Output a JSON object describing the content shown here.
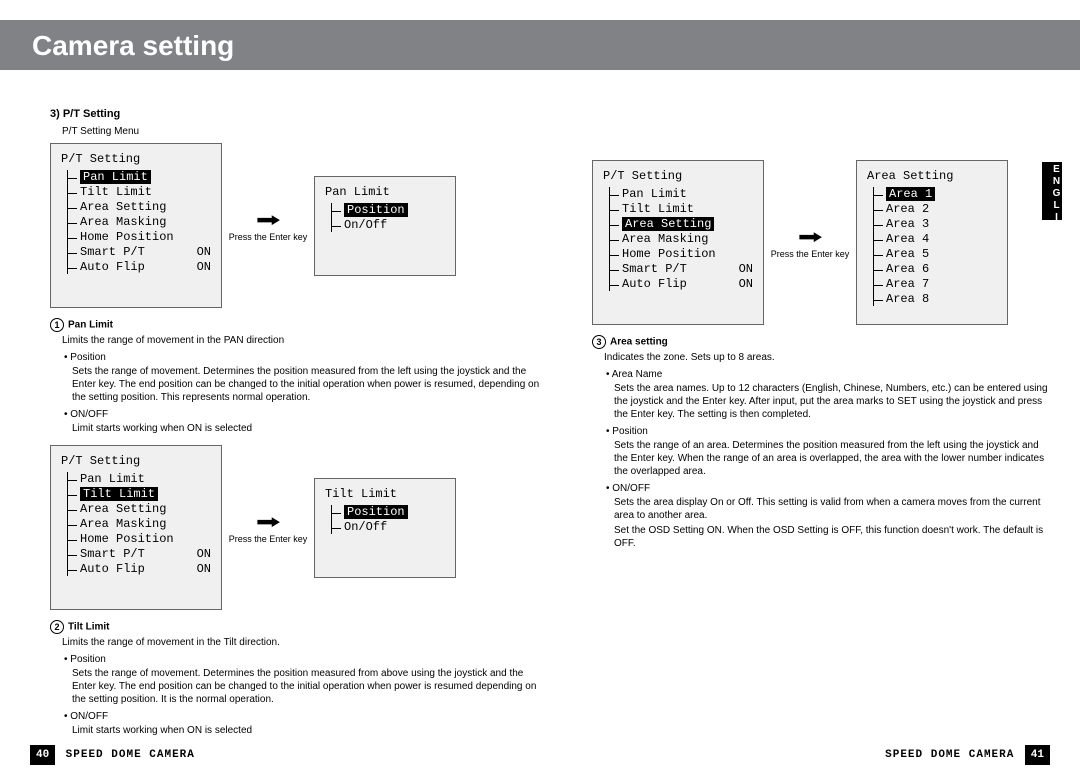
{
  "title": "Camera setting",
  "lang_tab": "ENGLISH",
  "section_heading": "3) P/T Setting",
  "menu_label": "P/T Setting Menu",
  "press_enter": "Press the Enter key",
  "pt_menu_title": "P/T Setting",
  "pt_items": {
    "pan": "Pan  Limit",
    "tilt": "Tilt Limit",
    "area_setting": "Area Setting",
    "area_masking": "Area Masking",
    "home": "Home Position",
    "smart": "Smart P/T",
    "smart_val": "ON",
    "autoflip": "Auto Flip",
    "autoflip_val": "ON"
  },
  "panlimit_title": "Pan Limit",
  "panlimit_items": {
    "position": "Position",
    "onoff": "On/Off"
  },
  "tiltlimit_title": "Tilt Limit",
  "tiltlimit_items": {
    "position": "Position",
    "onoff": "On/Off"
  },
  "area_title": "Area Setting",
  "area_names": [
    "Area 1",
    "Area 2",
    "Area 3",
    "Area 4",
    "Area 5",
    "Area 6",
    "Area 7",
    "Area 8"
  ],
  "item1": {
    "num": "1",
    "heading": "Pan Limit",
    "desc": "Limits the range of movement in the PAN direction",
    "b1": "Position",
    "b1d": "Sets the range of movement. Determines the position measured from the left using the joystick and the Enter key. The end position can be changed to the initial operation when power is resumed, depending on the setting position. This represents normal operation.",
    "b2": "ON/OFF",
    "b2d": "Limit starts working when ON is selected"
  },
  "item2": {
    "num": "2",
    "heading": "Tilt Limit",
    "desc": "Limits the range of movement in the Tilt direction.",
    "b1": "Position",
    "b1d": "Sets the range of movement. Determines the position measured from above using the joystick and the Enter key. The end position can be changed to the initial operation when power is resumed depending on the setting position. It is the normal operation.",
    "b2": "ON/OFF",
    "b2d": "Limit starts working when ON is selected"
  },
  "item3": {
    "num": "3",
    "heading": "Area setting",
    "desc": "Indicates the zone. Sets up to 8 areas.",
    "b1": "Area Name",
    "b1d": "Sets the area names. Up to 12 characters (English, Chinese, Numbers, etc.) can be entered using the joystick and the Enter key. After input, put the area marks to SET using the joystick and press the Enter key. The setting is then completed.",
    "b2": "Position",
    "b2d": "Sets the range of an area. Determines the position measured from the left using the joystick and the Enter key. When the range of an area is overlapped, the area with the lower number indicates the overlapped area.",
    "b3": "ON/OFF",
    "b3d": "Sets the area display On or Off. This setting is valid from when a camera moves from the current area to another area.",
    "b3d2": "Set the OSD Setting ON. When the OSD Setting is OFF, this function doesn't work. The default is OFF."
  },
  "footer": {
    "left_num": "40",
    "left_txt": "SPEED DOME CAMERA",
    "right_txt": "SPEED DOME CAMERA",
    "right_num": "41"
  }
}
